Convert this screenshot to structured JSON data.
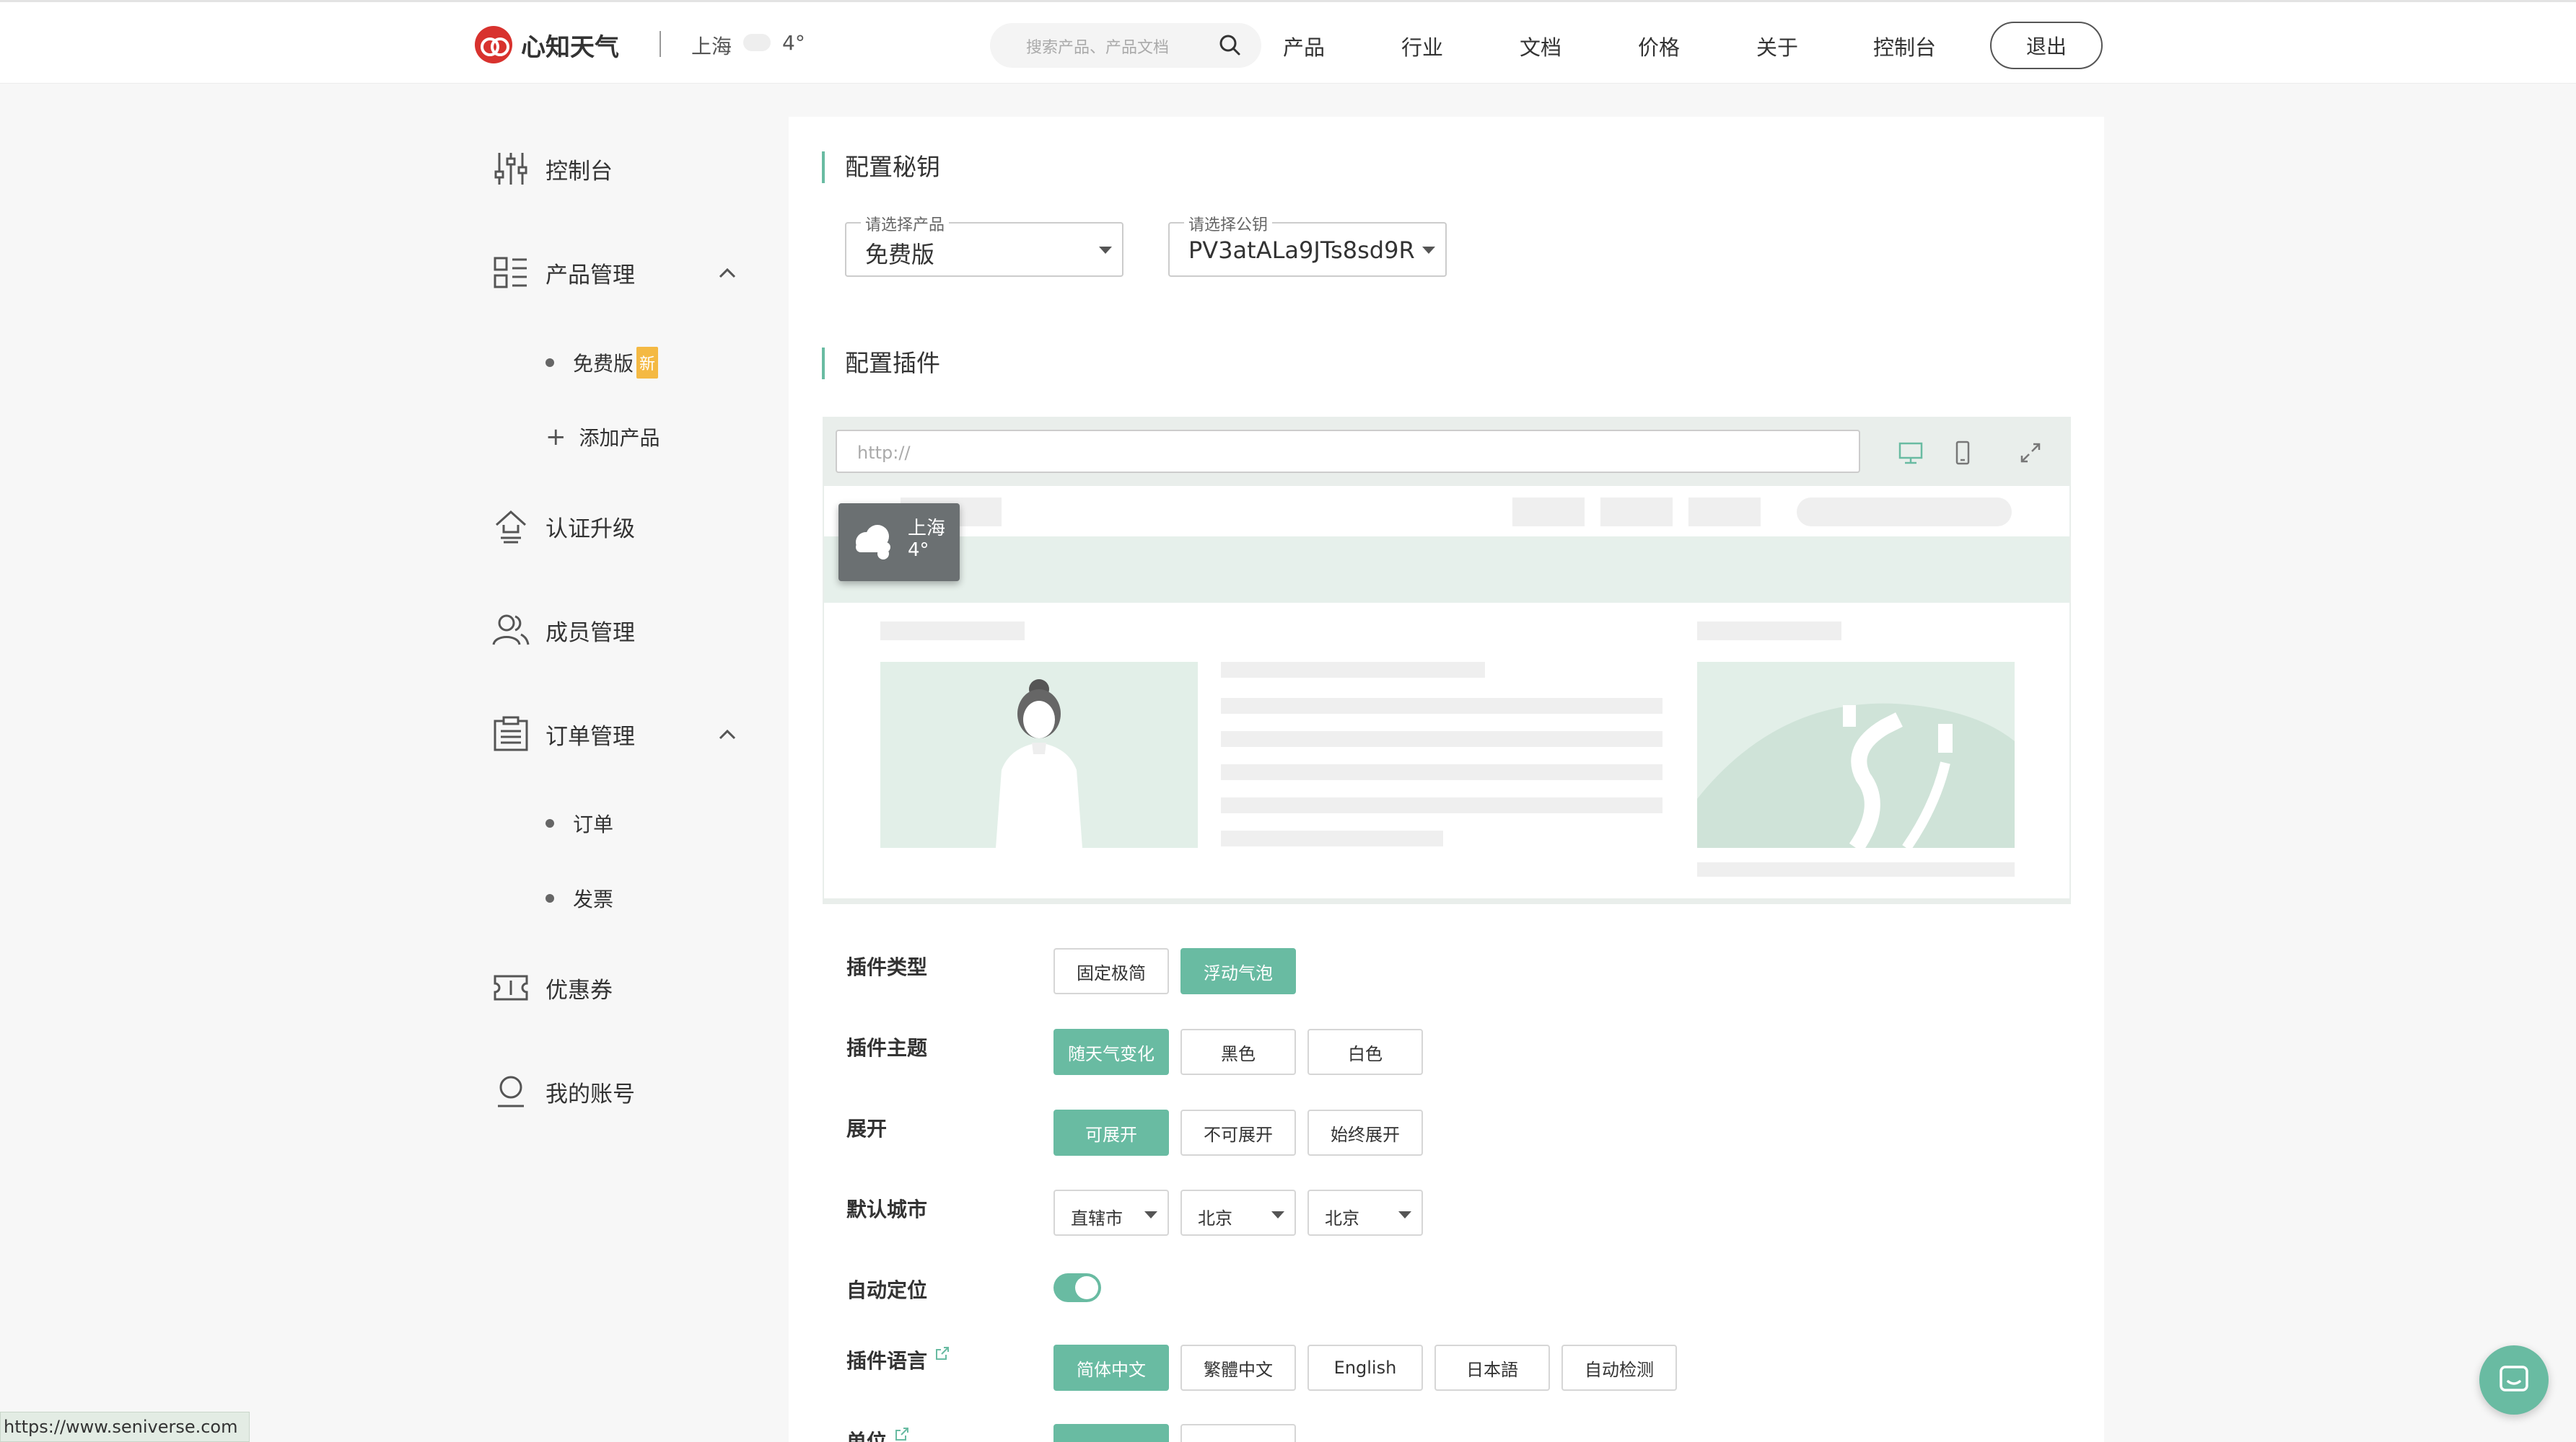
{
  "header": {
    "brand": "心知天气",
    "city": "上海",
    "temp": "4°",
    "search_placeholder": "搜索产品、产品文档",
    "nav": [
      "产品",
      "行业",
      "文档",
      "价格",
      "关于",
      "控制台"
    ],
    "logout": "退出"
  },
  "sidebar": {
    "items": [
      {
        "label": "控制台",
        "icon": "sliders-icon"
      },
      {
        "label": "产品管理",
        "icon": "grid-list-icon"
      },
      {
        "label": "认证升级",
        "icon": "upgrade-icon"
      },
      {
        "label": "成员管理",
        "icon": "users-icon"
      },
      {
        "label": "订单管理",
        "icon": "clipboard-icon"
      },
      {
        "label": "优惠券",
        "icon": "ticket-icon"
      },
      {
        "label": "我的账号",
        "icon": "user-icon"
      }
    ],
    "product_sub": {
      "free": "免费版",
      "new_badge": "新",
      "add": "添加产品"
    },
    "order_sub": {
      "orders": "订单",
      "invoices": "发票"
    }
  },
  "config_key": {
    "title": "配置秘钥",
    "product_legend": "请选择产品",
    "product_value": "免费版",
    "key_legend": "请选择公钥",
    "key_value": "PV3atALa9JTs8sd9R"
  },
  "config_plugin": {
    "title": "配置插件",
    "url_placeholder": "http://",
    "widget_city": "上海",
    "widget_temp": "4°"
  },
  "options": {
    "type": {
      "label": "插件类型",
      "buttons": [
        "固定极简",
        "浮动气泡"
      ],
      "active": 1
    },
    "theme": {
      "label": "插件主题",
      "buttons": [
        "随天气变化",
        "黑色",
        "白色"
      ],
      "active": 0
    },
    "expand": {
      "label": "展开",
      "buttons": [
        "可展开",
        "不可展开",
        "始终展开"
      ],
      "active": 0
    },
    "city": {
      "label": "默认城市",
      "selects": [
        "直辖市",
        "北京",
        "北京"
      ]
    },
    "auto_locate": {
      "label": "自动定位",
      "on": true
    },
    "language": {
      "label": "插件语言",
      "buttons": [
        "简体中文",
        "繁體中文",
        "English",
        "日本語",
        "自动检测"
      ],
      "active": 0
    },
    "unit": {
      "label": "单位"
    }
  },
  "status_url": "https://www.seniverse.com",
  "colors": {
    "accent": "#69bba2",
    "brand": "#d8322e",
    "badge": "#f4b943"
  }
}
